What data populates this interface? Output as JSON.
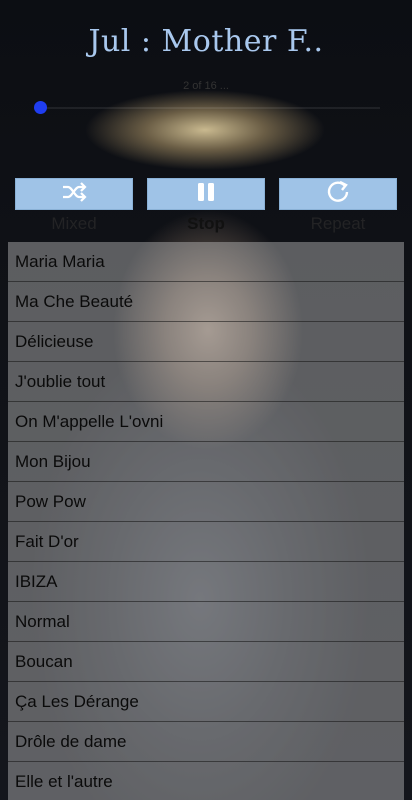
{
  "header": {
    "title": "Jul : Mother F.."
  },
  "player": {
    "time_text": "2 of 16 ...",
    "progress": 0.0
  },
  "controls": {
    "mixed_label": "Mixed",
    "stop_label": "Stop",
    "repeat_label": "Repeat"
  },
  "playlist": {
    "tracks": [
      "Maria Maria",
      "Ma Che Beauté",
      "Délicieuse",
      "J'oublie tout",
      "On M'appelle L'ovni",
      "Mon Bijou",
      "Pow Pow",
      "Fait D'or",
      "IBIZA",
      "Normal",
      "Boucan",
      "Ça Les Dérange",
      "Drôle de dame",
      "Elle et l'autre"
    ]
  },
  "colors": {
    "title": "#a9c8ee",
    "button": "#9fc3e7",
    "progress": "#1f3df0"
  },
  "icons": {
    "mixed": "shuffle-icon",
    "stop": "pause-icon",
    "repeat": "repeat-icon"
  }
}
